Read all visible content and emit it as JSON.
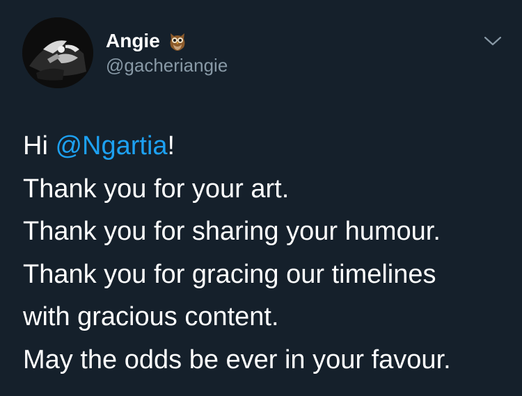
{
  "colors": {
    "background": "#15202b",
    "text_primary": "#ffffff",
    "text_secondary": "#8899a6",
    "link": "#1da1f2"
  },
  "author": {
    "display_name": "Angie",
    "name_emoji_icon": "owl-icon",
    "handle": "@gacheriangie",
    "avatar_icon": "avatar"
  },
  "menu": {
    "icon": "chevron-down-icon"
  },
  "tweet": {
    "line1_prefix": "Hi ",
    "line1_mention": "@Ngartia",
    "line1_suffix": "!",
    "line2": "Thank you for your art.",
    "line3": "Thank you for sharing your humour.",
    "line4": "Thank you for gracing our timelines",
    "line5": "with gracious content.",
    "line6": "May the odds be ever in your favour."
  }
}
